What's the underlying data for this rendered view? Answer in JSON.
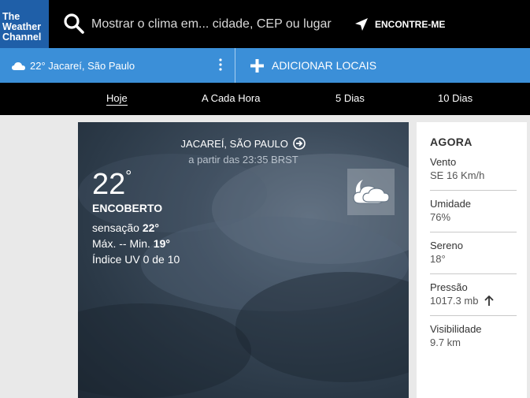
{
  "header": {
    "logo_lines": [
      "The",
      "Weather",
      "Channel"
    ],
    "search_placeholder": "Mostrar o clima em... cidade, CEP ou lugar",
    "locate_label": "ENCONTRE-ME"
  },
  "location_bar": {
    "current": "22° Jacareí, São Paulo",
    "add_label": "ADICIONAR LOCAIS"
  },
  "tabs": [
    {
      "label": "Hoje",
      "active": true
    },
    {
      "label": "A Cada Hora"
    },
    {
      "label": "5 Dias"
    },
    {
      "label": "10 Dias"
    }
  ],
  "hero": {
    "location": "JACAREÍ, SÃO PAULO",
    "updated": "a partir das 23:35 BRST",
    "temperature": "22",
    "temp_unit": "°",
    "condition": "ENCOBERTO",
    "feels_label": "sensação",
    "feels_value": "22°",
    "maxmin_label": "Máx. -- Min.",
    "min_value": "19°",
    "uv": "Índice UV 0 de 10",
    "icon": "partly-cloudy-night-icon"
  },
  "now_panel": {
    "title": "AGORA",
    "stats": [
      {
        "label": "Vento",
        "value": "SE 16 Km/h"
      },
      {
        "label": "Umidade",
        "value": "76%"
      },
      {
        "label": "Sereno",
        "value": "18°"
      },
      {
        "label": "Pressão",
        "value": "1017.3 mb"
      },
      {
        "label": "Visibilidade",
        "value": "9.7 km"
      }
    ]
  },
  "colors": {
    "brand_blue": "#1f5fa8",
    "location_bar": "#3b8fd8",
    "top_bar": "#000000"
  }
}
